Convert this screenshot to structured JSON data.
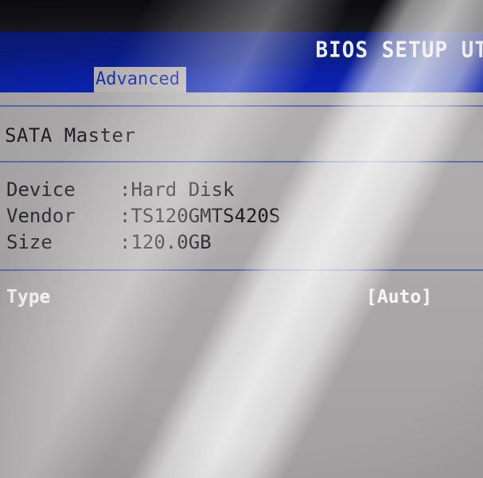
{
  "header": {
    "title": "BIOS SETUP UT"
  },
  "tabs": [
    {
      "label": "Advanced",
      "active": true
    }
  ],
  "section": {
    "title": "SATA Master"
  },
  "device_info": [
    {
      "label": "Device",
      "value": ":Hard Disk"
    },
    {
      "label": "Vendor",
      "value": ":TS120GMTS420S"
    },
    {
      "label": "Size",
      "value": ":120.0GB"
    }
  ],
  "options": [
    {
      "label": "Type",
      "value": "[Auto]"
    }
  ],
  "colors": {
    "title_bar": "#0a1f95",
    "tab_bar": "#0c24b6",
    "background": "#b3b0b1",
    "active_tab_text": "#1b2ea8",
    "selected_option_text": "#f4f4f4"
  }
}
